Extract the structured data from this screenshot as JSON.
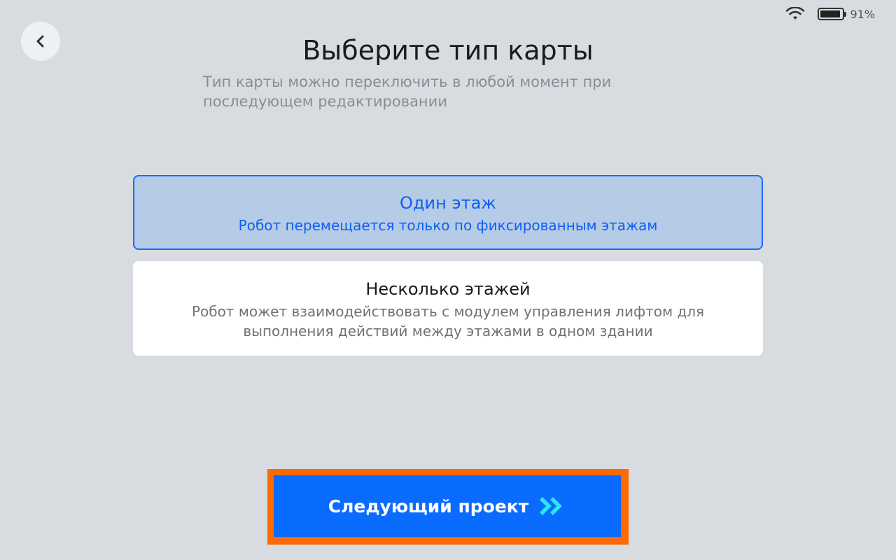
{
  "status_bar": {
    "battery_text": "91%",
    "battery_level": 0.91,
    "wifi_icon": "wifi-icon",
    "battery_icon": "battery-icon"
  },
  "header": {
    "back_icon": "chevron-left-icon",
    "title": "Выберите тип карты",
    "subtitle": "Тип карты можно переключить в любой момент при последующем редактировании"
  },
  "options": [
    {
      "title": "Один этаж",
      "description": "Робот перемещается только по фиксированным этажам",
      "selected": true
    },
    {
      "title": "Несколько этажей",
      "description": "Робот может взаимодействовать с модулем управления лифтом для выполнения действий между этажами в одном здании",
      "selected": false
    }
  ],
  "footer": {
    "next_label": "Следующий проект",
    "next_icon": "double-chevron-right-icon"
  },
  "colors": {
    "background": "#d8dce0",
    "accent": "#0a6cff",
    "selected_fill": "#b6cce6",
    "highlight_border": "#ff6a00",
    "chevron": "#2ee6f0"
  }
}
